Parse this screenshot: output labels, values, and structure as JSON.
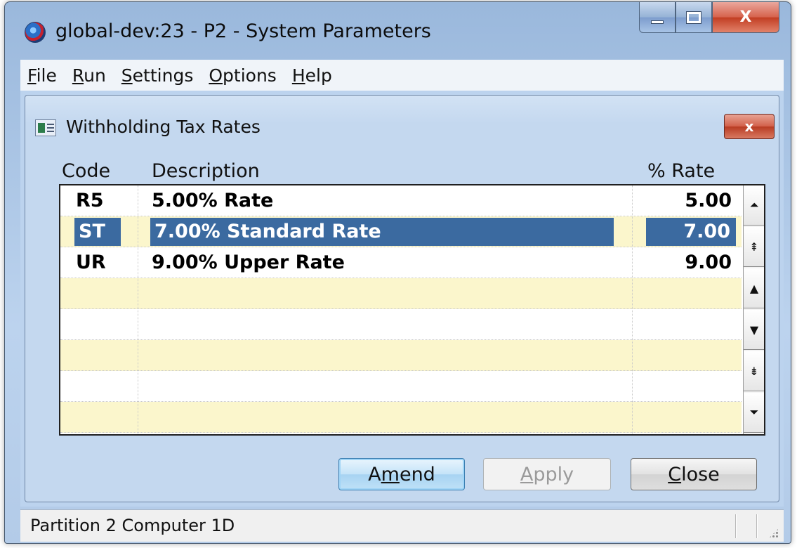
{
  "window": {
    "title": "global-dev:23 - P2 - System Parameters",
    "caption_buttons": [
      "minimize-icon",
      "maximize-icon",
      "close-icon"
    ],
    "close_glyph": "X"
  },
  "menu": {
    "items": [
      {
        "label": "File",
        "mnemonic": "F"
      },
      {
        "label": "Run",
        "mnemonic": "R"
      },
      {
        "label": "Settings",
        "mnemonic": "S"
      },
      {
        "label": "Options",
        "mnemonic": "O"
      },
      {
        "label": "Help",
        "mnemonic": "H"
      }
    ]
  },
  "dialog": {
    "title": "Withholding Tax Rates",
    "close_glyph": "x",
    "icon": "table-window-icon"
  },
  "table": {
    "headers": {
      "code": "Code",
      "description": "Description",
      "rate": "% Rate"
    },
    "rows": [
      {
        "code": "R5",
        "description": "5.00% Rate",
        "rate": "5.00",
        "selected": false
      },
      {
        "code": "ST",
        "description": "7.00% Standard Rate",
        "rate": "7.00",
        "selected": true
      },
      {
        "code": "UR",
        "description": "9.00% Upper Rate",
        "rate": "9.00",
        "selected": false
      },
      {
        "code": "",
        "description": "",
        "rate": "",
        "selected": false
      },
      {
        "code": "",
        "description": "",
        "rate": "",
        "selected": false
      },
      {
        "code": "",
        "description": "",
        "rate": "",
        "selected": false
      },
      {
        "code": "",
        "description": "",
        "rate": "",
        "selected": false
      },
      {
        "code": "",
        "description": "",
        "rate": "",
        "selected": false
      }
    ]
  },
  "scroller": {
    "buttons": [
      {
        "name": "scroll-top",
        "glyph": "⏶"
      },
      {
        "name": "scroll-page-up",
        "glyph": "⇞"
      },
      {
        "name": "scroll-up",
        "glyph": "▲"
      },
      {
        "name": "scroll-down",
        "glyph": "▼"
      },
      {
        "name": "scroll-page-down",
        "glyph": "⇟"
      },
      {
        "name": "scroll-bottom",
        "glyph": "⏷"
      }
    ]
  },
  "buttons": {
    "amend": {
      "pre": "A",
      "mnemonic": "m",
      "post": "end"
    },
    "apply": {
      "pre": "",
      "mnemonic": "A",
      "post": "pply",
      "enabled": false
    },
    "close": {
      "pre": "",
      "mnemonic": "C",
      "post": "lose"
    }
  },
  "status": {
    "text": "Partition 2 Computer 1D"
  },
  "colors": {
    "selection": "#3b6aa0",
    "row_alt": "#fbf6cc",
    "frame": "#bcd3ee"
  }
}
